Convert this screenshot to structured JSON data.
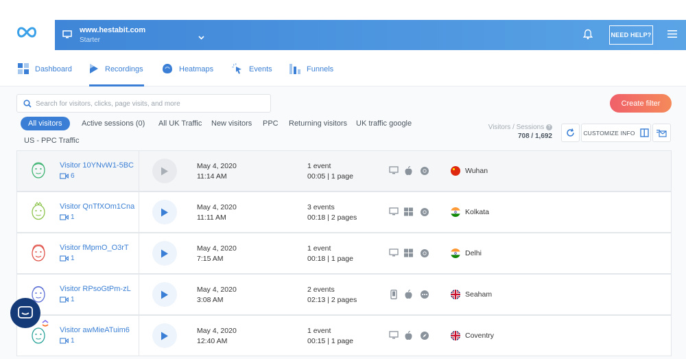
{
  "header": {
    "site_name": "www.hestabit.com",
    "site_plan": "Starter",
    "help_label": "NEED HELP?"
  },
  "nav": [
    {
      "label": "Dashboard",
      "icon": "dashboard-icon"
    },
    {
      "label": "Recordings",
      "icon": "recordings-icon",
      "active": true
    },
    {
      "label": "Heatmaps",
      "icon": "heatmaps-icon"
    },
    {
      "label": "Events",
      "icon": "events-icon"
    },
    {
      "label": "Funnels",
      "icon": "funnels-icon"
    }
  ],
  "search": {
    "placeholder": "Search for visitors, clicks, page visits, and more"
  },
  "create_filter_label": "Create filter",
  "segments": [
    {
      "label": "All visitors",
      "active": true
    },
    {
      "label": "Active sessions (0)"
    },
    {
      "label": "All UK Traffic"
    },
    {
      "label": "New visitors"
    },
    {
      "label": "PPC"
    },
    {
      "label": "Returning visitors"
    },
    {
      "label": "UK traffic google"
    },
    {
      "label": "US - PPC Traffic"
    }
  ],
  "stats": {
    "label": "Visitors / Sessions",
    "value": "708 / 1,692"
  },
  "customize_label": "CUSTOMIZE INFO",
  "rows": [
    {
      "visitor": "Visitor 10YNvW1-5BC",
      "sessions": "6",
      "date": "May 4, 2020",
      "time": "11:14 AM",
      "events": "1 event",
      "pages": "00:05 | 1 page",
      "device": "desktop-icon",
      "os": "apple-icon",
      "browser": "chrome-icon",
      "flag": "china-flag",
      "city": "Wuhan",
      "avatar_color": "#3cb371"
    },
    {
      "visitor": "Visitor QnTfXOm1Cna",
      "sessions": "1",
      "date": "May 4, 2020",
      "time": "11:11 AM",
      "events": "3 events",
      "pages": "00:18 | 2 pages",
      "device": "desktop-icon",
      "os": "windows-icon",
      "browser": "chrome-icon",
      "flag": "india-flag",
      "city": "Kolkata",
      "avatar_color": "#8bc34a"
    },
    {
      "visitor": "Visitor fMpmO_O3rT",
      "sessions": "1",
      "date": "May 4, 2020",
      "time": "7:15 AM",
      "events": "1 event",
      "pages": "00:18 | 1 page",
      "device": "desktop-icon",
      "os": "windows-icon",
      "browser": "chrome-icon",
      "flag": "india-flag",
      "city": "Delhi",
      "avatar_color": "#e0534a"
    },
    {
      "visitor": "Visitor RPsoGtPm-zL",
      "sessions": "1",
      "date": "May 4, 2020",
      "time": "3:08 AM",
      "events": "2 events",
      "pages": "02:13 | 2 pages",
      "device": "mobile-icon",
      "os": "apple-icon",
      "browser": "other-browser-icon",
      "flag": "uk-flag",
      "city": "Seaham",
      "avatar_color": "#5b6fd6"
    },
    {
      "visitor": "Visitor awMieATuim6",
      "sessions": "1",
      "date": "May 4, 2020",
      "time": "12:40 AM",
      "events": "1 event",
      "pages": "00:15 | 1 page",
      "device": "desktop-icon",
      "os": "apple-icon",
      "browser": "safari-icon",
      "flag": "uk-flag",
      "city": "Coventry",
      "avatar_color": "#2aa39a"
    }
  ],
  "colors": {
    "accent": "#3a7fd5",
    "create_filter": "#f0606a",
    "header_gradient_start": "#3f86d8"
  }
}
